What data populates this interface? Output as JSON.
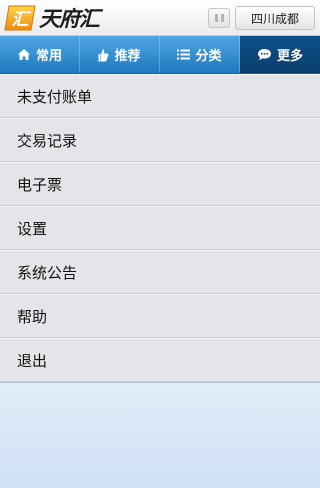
{
  "header": {
    "logo_text": "天府汇",
    "logo_mark_char": "汇",
    "pause_icon": "pause-icon",
    "city_label": "四川成都"
  },
  "tabs": [
    {
      "label": "常用",
      "icon": "home-icon"
    },
    {
      "label": "推荐",
      "icon": "thumb-up-icon"
    },
    {
      "label": "分类",
      "icon": "list-icon"
    },
    {
      "label": "更多",
      "icon": "chat-bubble-icon",
      "active": true
    }
  ],
  "menu": {
    "items": [
      {
        "label": "未支付账单"
      },
      {
        "label": "交易记录"
      },
      {
        "label": "电子票"
      },
      {
        "label": "设置"
      },
      {
        "label": "系统公告"
      },
      {
        "label": "帮助"
      },
      {
        "label": "退出"
      }
    ]
  },
  "colors": {
    "tab_bar": "#2b8bd4",
    "tab_active": "#0b4477",
    "menu_bg": "#e5e5e9",
    "logo_orange": "#f4a21c"
  }
}
